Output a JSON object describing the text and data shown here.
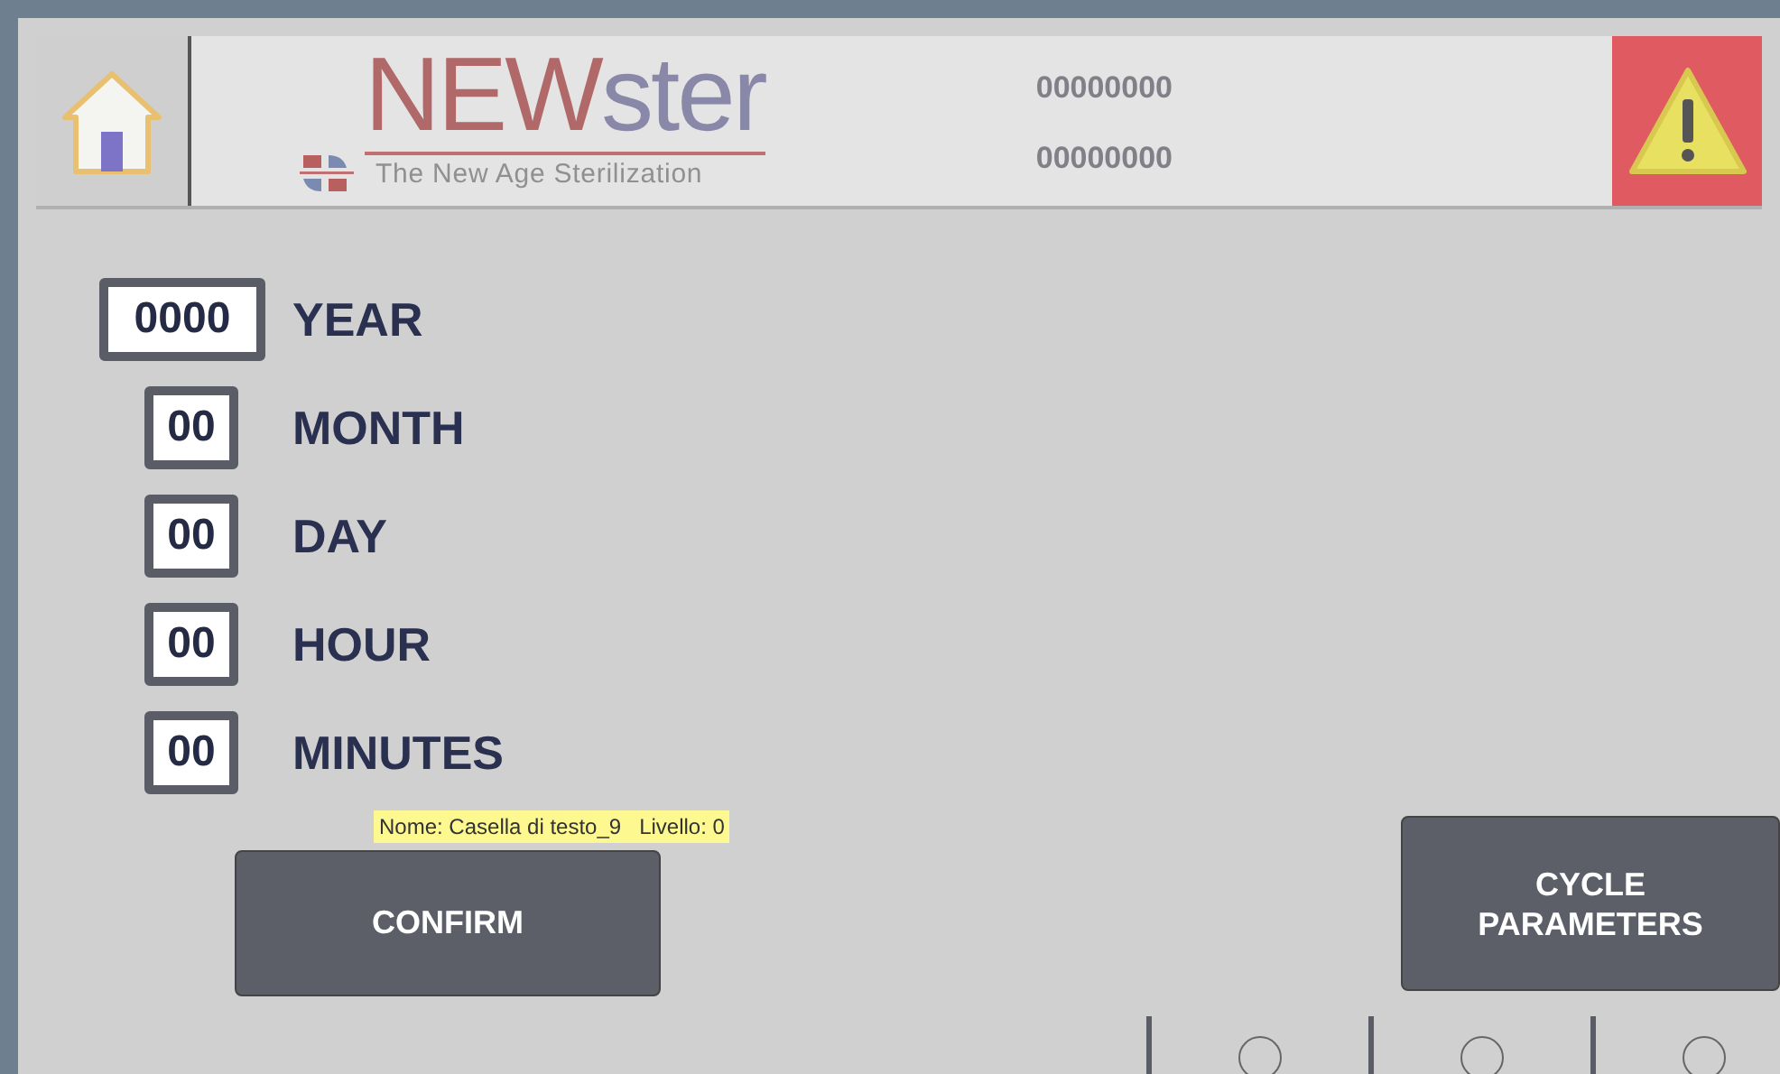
{
  "header": {
    "logo": {
      "prefix": "NEW",
      "suffix": "ster",
      "tagline": "The New Age Sterilization"
    },
    "codes": [
      "00000000",
      "00000000"
    ]
  },
  "fields": [
    {
      "kind": "wide",
      "value": "0000",
      "label": "YEAR"
    },
    {
      "kind": "narrow",
      "value": "00",
      "label": "MONTH"
    },
    {
      "kind": "narrow",
      "value": "00",
      "label": "DAY"
    },
    {
      "kind": "narrow",
      "value": "00",
      "label": "HOUR"
    },
    {
      "kind": "narrow",
      "value": "00",
      "label": "MINUTES"
    }
  ],
  "tooltip": "Nome: Casella di testo_9   Livello: 0",
  "buttons": {
    "confirm": "CONFIRM",
    "cycle": [
      "CYCLE",
      "PARAMETERS"
    ]
  },
  "indicators": [
    {
      "selected": false
    },
    {
      "selected": false
    },
    {
      "selected": false
    }
  ]
}
